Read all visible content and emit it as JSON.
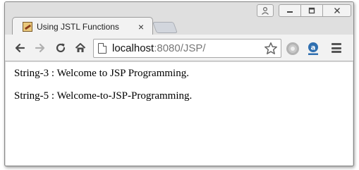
{
  "browser": {
    "tab": {
      "title": "Using JSTL Functions",
      "close_glyph": "×",
      "favicon": "java-favicon-icon"
    },
    "address_bar": {
      "host": "localhost",
      "rest": ":8080/JSP/"
    },
    "icons": {
      "back": "back-arrow-icon",
      "forward": "forward-arrow-icon",
      "reload": "reload-icon",
      "home": "home-icon",
      "bookmark": "star-icon",
      "extension_1": "circle-extension-icon",
      "extension_2": "amazon-assistant-icon",
      "menu": "hamburger-menu-icon",
      "user": "user-icon"
    }
  },
  "page": {
    "lines": [
      "String-3 : Welcome to JSP Programming.",
      "String-5 : Welcome-to-JSP-Programming."
    ]
  }
}
